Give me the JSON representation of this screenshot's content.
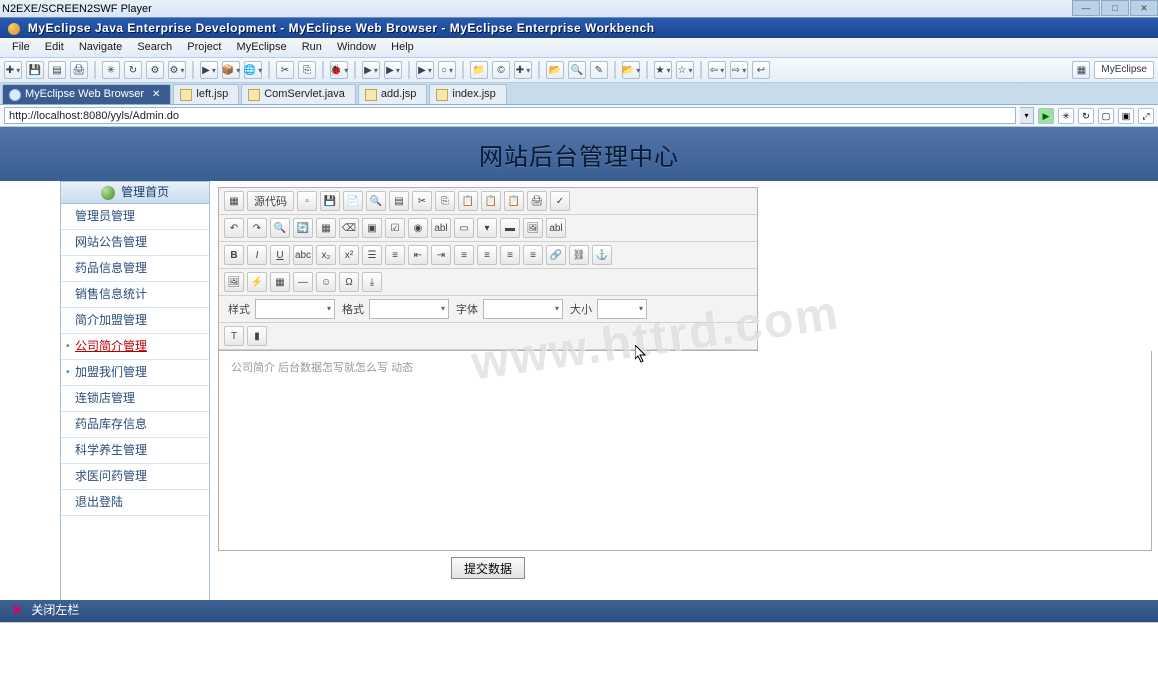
{
  "os_title": "N2EXE/SCREEN2SWF Player",
  "app_title": "MyEclipse Java Enterprise Development - MyEclipse Web Browser - MyEclipse Enterprise Workbench",
  "menus": [
    "File",
    "Edit",
    "Navigate",
    "Search",
    "Project",
    "MyEclipse",
    "Run",
    "Window",
    "Help"
  ],
  "perspective": "MyEclipse",
  "editor_tabs": [
    {
      "label": "MyEclipse Web Browser",
      "active": true,
      "closeable": true
    },
    {
      "label": "left.jsp",
      "active": false,
      "closeable": false
    },
    {
      "label": "ComServlet.java",
      "active": false,
      "closeable": false
    },
    {
      "label": "add.jsp",
      "active": false,
      "closeable": false
    },
    {
      "label": "index.jsp",
      "active": false,
      "closeable": false
    }
  ],
  "address_url": "http://localhost:8080/yyls/Admin.do",
  "page_header": "网站后台管理中心",
  "sidebar": {
    "title": "管理首页",
    "items": [
      {
        "label": "管理员管理",
        "sel": false,
        "bull": false
      },
      {
        "label": "网站公告管理",
        "sel": false,
        "bull": false
      },
      {
        "label": "药品信息管理",
        "sel": false,
        "bull": false
      },
      {
        "label": "销售信息统计",
        "sel": false,
        "bull": false
      },
      {
        "label": "简介加盟管理",
        "sel": false,
        "bull": false
      },
      {
        "label": "公司简介管理",
        "sel": true,
        "bull": true
      },
      {
        "label": "加盟我们管理",
        "sel": false,
        "bull": true
      },
      {
        "label": "连锁店管理",
        "sel": false,
        "bull": false
      },
      {
        "label": "药品库存信息",
        "sel": false,
        "bull": false
      },
      {
        "label": "科学养生管理",
        "sel": false,
        "bull": false
      },
      {
        "label": "求医问药管理",
        "sel": false,
        "bull": false
      },
      {
        "label": "退出登陆",
        "sel": false,
        "bull": false
      }
    ]
  },
  "ck": {
    "source_btn": "源代码",
    "style_label": "样式",
    "format_label": "格式",
    "font_label": "字体",
    "size_label": "大小",
    "editor_text": "公司简介 后台数据怎写就怎么写 动态"
  },
  "submit_label": "提交数据",
  "footer_close": "关闭左栏",
  "watermark": "www.httrd.com"
}
